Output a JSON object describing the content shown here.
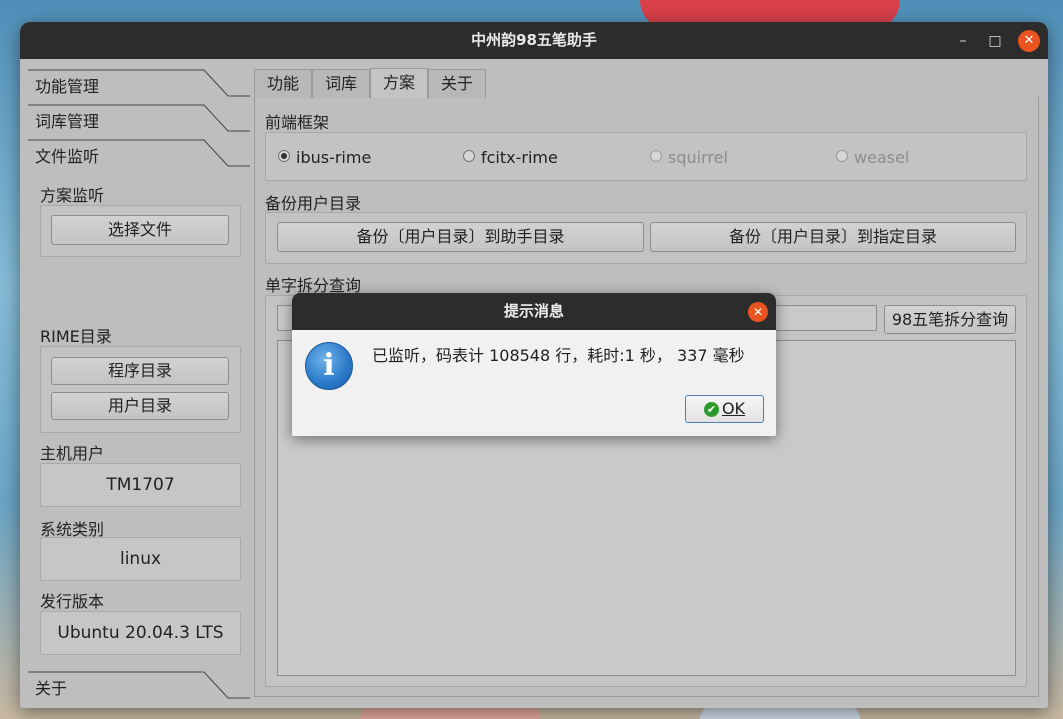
{
  "window": {
    "title": "中州韵98五笔助手",
    "controls": {
      "minimize": "–",
      "maximize": "□",
      "close": "✕"
    }
  },
  "sidebar": {
    "items": [
      {
        "label": "功能管理"
      },
      {
        "label": "词库管理"
      },
      {
        "label": "文件监听"
      }
    ],
    "scheme_monitor": {
      "label": "方案监听",
      "select_file": "选择文件"
    },
    "rime_dir": {
      "label": "RIME目录",
      "program_dir": "程序目录",
      "user_dir": "用户目录"
    },
    "host_user": {
      "label": "主机用户",
      "value": "TM1707"
    },
    "system_type": {
      "label": "系统类别",
      "value": "linux"
    },
    "release": {
      "label": "发行版本",
      "value": "Ubuntu 20.04.3 LTS"
    },
    "about": {
      "label": "关于"
    }
  },
  "tabs": [
    {
      "label": "功能",
      "active": false
    },
    {
      "label": "词库",
      "active": false
    },
    {
      "label": "方案",
      "active": true
    },
    {
      "label": "关于",
      "active": false
    }
  ],
  "frontend": {
    "label": "前端框架",
    "options": [
      {
        "label": "ibus-rime",
        "checked": true,
        "enabled": true
      },
      {
        "label": "fcitx-rime",
        "checked": false,
        "enabled": true
      },
      {
        "label": "squirrel",
        "checked": false,
        "enabled": false
      },
      {
        "label": "weasel",
        "checked": false,
        "enabled": false
      }
    ]
  },
  "backup": {
    "label": "备份用户目录",
    "to_helper": "备份〔用户目录〕到助手目录",
    "to_custom": "备份〔用户目录〕到指定目录"
  },
  "split_query": {
    "label": "单字拆分查询",
    "input_value": "",
    "button": "98五笔拆分查询",
    "result": ""
  },
  "dialog": {
    "title": "提示消息",
    "icon": "i",
    "message": "已监听，码表计 108548 行，耗时:1 秒， 337 毫秒",
    "ok": "OK",
    "close": "✕"
  }
}
